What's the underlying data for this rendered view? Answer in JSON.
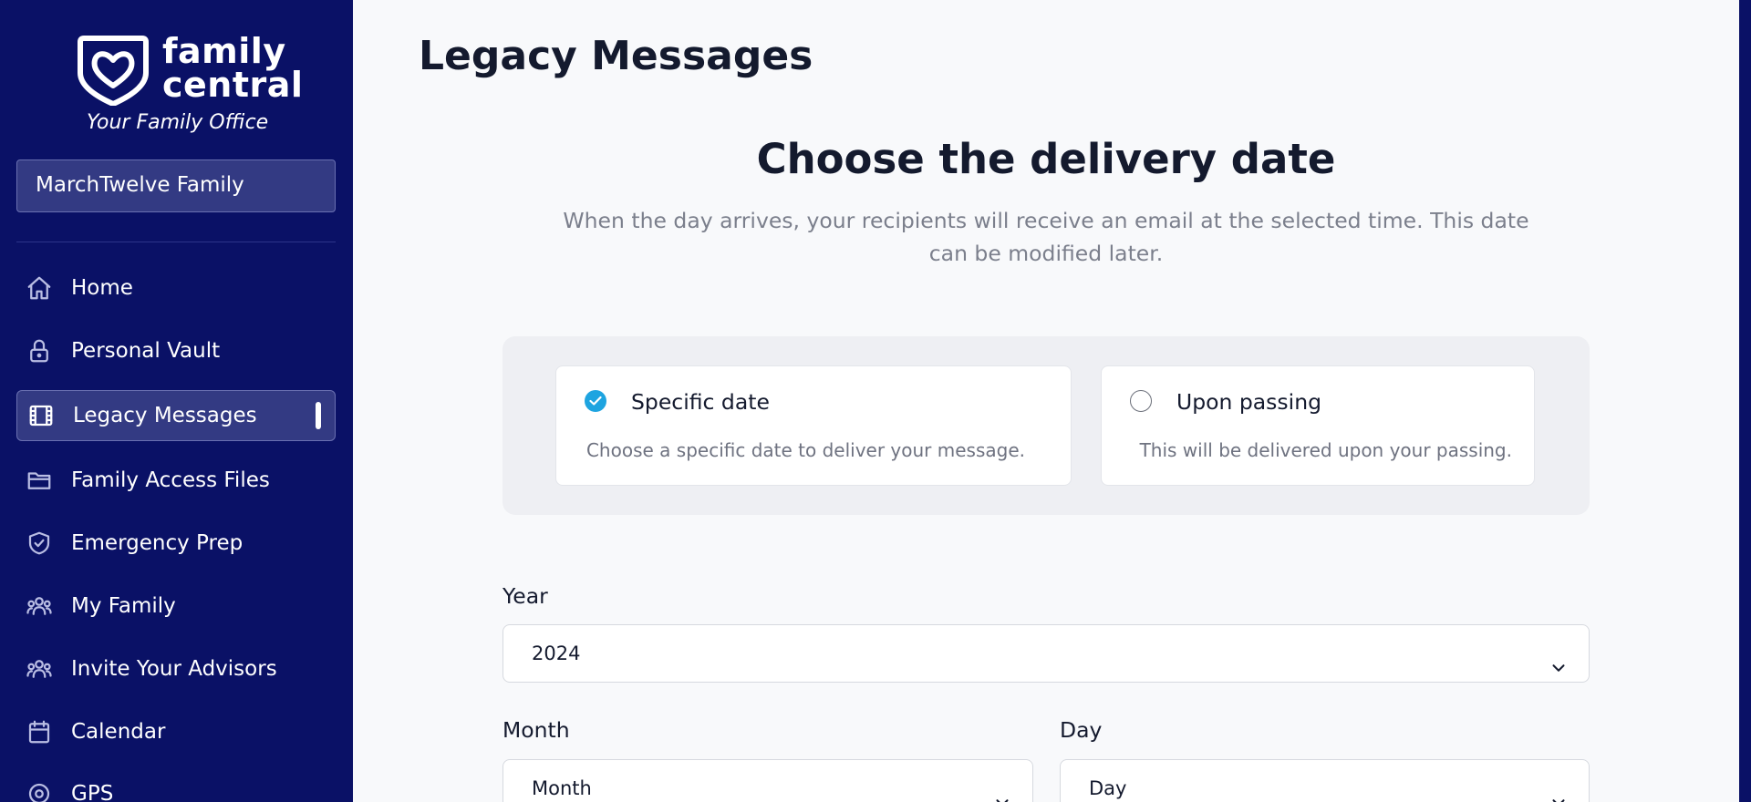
{
  "app": {
    "logo_text_line1": "family",
    "logo_text_line2": "central",
    "tagline": "Your Family Office"
  },
  "sidebar": {
    "family_selector": "MarchTwelve Family",
    "items": [
      {
        "label": "Home",
        "icon": "home-icon"
      },
      {
        "label": "Personal Vault",
        "icon": "lock-icon"
      },
      {
        "label": "Legacy Messages",
        "icon": "film-icon",
        "active": true
      },
      {
        "label": "Family Access Files",
        "icon": "folder-icon"
      },
      {
        "label": "Emergency Prep",
        "icon": "shield-check-icon"
      },
      {
        "label": "My Family",
        "icon": "users-icon"
      },
      {
        "label": "Invite Your Advisors",
        "icon": "users-icon"
      },
      {
        "label": "Calendar",
        "icon": "calendar-icon"
      },
      {
        "label": "GPS",
        "icon": "location-target-icon"
      }
    ]
  },
  "main": {
    "page_title": "Legacy Messages",
    "heading": "Choose the delivery date",
    "subtitle": "When the day arrives, your recipients will receive an email at the selected time. This date can be modified later.",
    "options": [
      {
        "title": "Specific date",
        "description": "Choose a specific date to deliver your message.",
        "selected": true
      },
      {
        "title": "Upon passing",
        "description": "This will be delivered upon your passing.",
        "selected": false
      }
    ],
    "year": {
      "label": "Year",
      "value": "2024"
    },
    "month": {
      "label": "Month",
      "value": "Month"
    },
    "day": {
      "label": "Day",
      "value": "Day"
    }
  },
  "colors": {
    "sidebar_bg": "#0a1166",
    "active_item_bg": "#333a83",
    "accent": "#1ea4e0",
    "page_bg": "#f8f9fb"
  }
}
